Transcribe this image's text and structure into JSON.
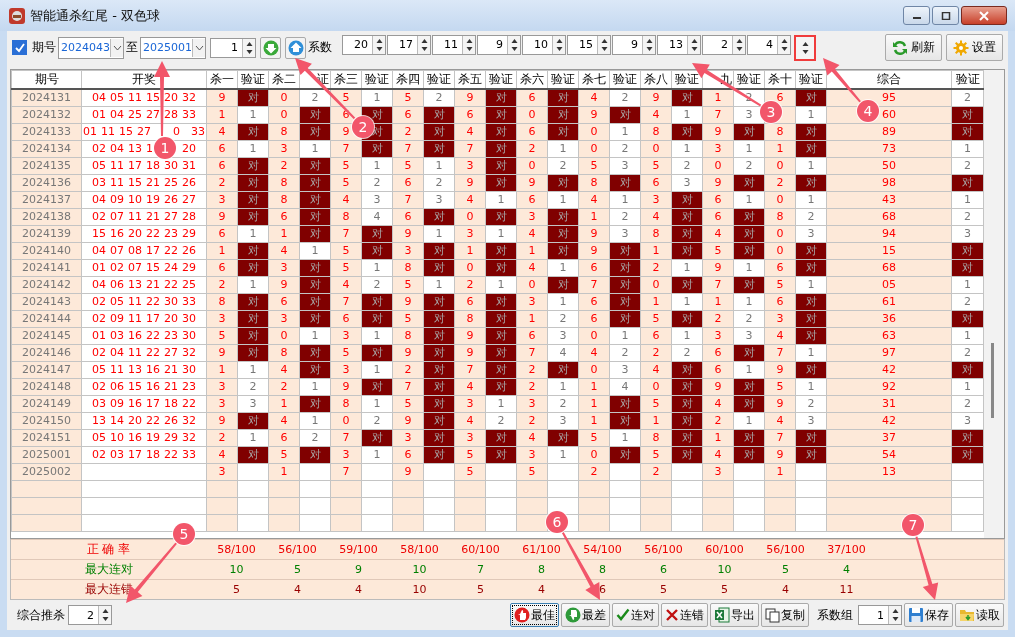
{
  "window": {
    "title": "智能通杀红尾 - 双色球"
  },
  "toolbar": {
    "period_checkbox": {
      "label": "期号",
      "checked": true
    },
    "from": "2024043",
    "to_label": "至",
    "to": "2025001",
    "step": "1",
    "coef_label": "系数",
    "coefficients": [
      "20",
      "17",
      "11",
      "9",
      "10",
      "15",
      "9",
      "13",
      "2",
      "4"
    ],
    "buttons": [
      {
        "label": "刷新"
      },
      {
        "label": "设置"
      }
    ]
  },
  "table": {
    "columns": [
      "期号",
      "开奖",
      "杀一",
      "验证",
      "杀二",
      "证",
      "杀三",
      "验证",
      "杀四",
      "验证",
      "杀五",
      "验证",
      "杀六",
      "验证",
      "杀七",
      "验证",
      "杀八",
      "验证",
      "九",
      "验证",
      "杀十",
      "验证",
      "综合",
      "验证"
    ],
    "rows": [
      {
        "period": "2024131",
        "balls": [
          "04",
          "05",
          "11",
          "15",
          "20",
          "32"
        ],
        "kills": [
          "9",
          "0",
          "5",
          "5",
          "9",
          "6",
          "4",
          "9",
          "1",
          "6"
        ],
        "total": "95",
        "checks": [
          "对",
          "2",
          "1",
          "2",
          "对",
          "对",
          "2",
          "对",
          "2",
          "对",
          "2"
        ],
        "hits": [
          true,
          false,
          false,
          false,
          true,
          true,
          false,
          true,
          false,
          true,
          false
        ]
      },
      {
        "period": "2024132",
        "balls": [
          "01",
          "04",
          "25",
          "27",
          "28",
          "33"
        ],
        "kills": [
          "1",
          "0",
          "6",
          "6",
          "6",
          "0",
          "9",
          "4",
          "7"
        ],
        "total": "60",
        "checks": [
          "1",
          "对",
          "对",
          "对",
          "对",
          "对",
          "对",
          "1",
          "3",
          "1",
          "对"
        ],
        "hits": [
          false,
          true,
          true,
          true,
          true,
          true,
          true,
          false,
          false,
          false,
          true
        ]
      },
      {
        "period": "2024133",
        "balls": [
          "01",
          "11",
          "15",
          "27"
        ],
        "balls_end": [
          "0",
          "33"
        ],
        "kills": [
          "4",
          "8",
          "9",
          "2",
          "4",
          "6",
          "0",
          "8",
          "9",
          "8"
        ],
        "total": "89",
        "checks": [
          "对",
          "对",
          "对",
          "对",
          "对",
          "对",
          "1",
          "对",
          "对",
          "对",
          "对"
        ],
        "hits": [
          true,
          true,
          true,
          true,
          true,
          true,
          false,
          true,
          true,
          true,
          true
        ]
      },
      {
        "period": "2024134",
        "balls": [
          "02",
          "04",
          "13",
          "1"
        ],
        "balls_end": [
          "20"
        ],
        "kills": [
          "6",
          "3",
          "7",
          "7",
          "7",
          "2",
          "0",
          "0",
          "3",
          "1"
        ],
        "total": "73",
        "checks": [
          "1",
          "1",
          "对",
          "对",
          "对",
          "1",
          "2",
          "1",
          "1",
          "对",
          "1"
        ],
        "hits": [
          false,
          false,
          true,
          true,
          true,
          false,
          false,
          false,
          false,
          true,
          false
        ]
      },
      {
        "period": "2024135",
        "balls": [
          "05",
          "11",
          "17",
          "18",
          "30",
          "31"
        ],
        "kills": [
          "6",
          "2",
          "5",
          "5",
          "3",
          "0",
          "5",
          "5",
          "0",
          "0"
        ],
        "total": "50",
        "checks": [
          "对",
          "对",
          "1",
          "1",
          "对",
          "2",
          "3",
          "2",
          "2",
          "1",
          "2"
        ],
        "hits": [
          true,
          true,
          false,
          false,
          true,
          false,
          false,
          false,
          false,
          false,
          false
        ]
      },
      {
        "period": "2024136",
        "balls": [
          "03",
          "11",
          "15",
          "21",
          "25",
          "26"
        ],
        "kills": [
          "2",
          "8",
          "5",
          "6",
          "9",
          "9",
          "8",
          "6",
          "9",
          "2"
        ],
        "total": "98",
        "checks": [
          "对",
          "对",
          "2",
          "2",
          "对",
          "对",
          "对",
          "3",
          "对",
          "对",
          "对"
        ],
        "hits": [
          true,
          true,
          false,
          false,
          true,
          true,
          true,
          false,
          true,
          true,
          true
        ]
      },
      {
        "period": "2024137",
        "balls": [
          "04",
          "09",
          "10",
          "19",
          "26",
          "27"
        ],
        "kills": [
          "3",
          "8",
          "4",
          "7",
          "4",
          "6",
          "4",
          "3",
          "6",
          "0"
        ],
        "total": "43",
        "checks": [
          "对",
          "对",
          "3",
          "3",
          "1",
          "1",
          "1",
          "对",
          "1",
          "1",
          "1"
        ],
        "hits": [
          true,
          true,
          false,
          false,
          false,
          false,
          false,
          true,
          false,
          false,
          false
        ]
      },
      {
        "period": "2024138",
        "balls": [
          "02",
          "07",
          "11",
          "21",
          "27",
          "28"
        ],
        "kills": [
          "9",
          "6",
          "8",
          "6",
          "0",
          "3",
          "1",
          "4",
          "6",
          "8"
        ],
        "total": "68",
        "checks": [
          "对",
          "对",
          "4",
          "对",
          "对",
          "对",
          "2",
          "对",
          "对",
          "2",
          "2"
        ],
        "hits": [
          true,
          true,
          false,
          true,
          true,
          true,
          false,
          true,
          true,
          false,
          false
        ]
      },
      {
        "period": "2024139",
        "balls": [
          "15",
          "16",
          "20",
          "22",
          "23",
          "29"
        ],
        "kills": [
          "6",
          "1",
          "7",
          "9",
          "3",
          "4",
          "9",
          "8",
          "4",
          "0"
        ],
        "total": "94",
        "checks": [
          "1",
          "对",
          "对",
          "1",
          "1",
          "对",
          "3",
          "对",
          "对",
          "3",
          "3"
        ],
        "hits": [
          false,
          true,
          true,
          false,
          false,
          true,
          false,
          true,
          true,
          false,
          false
        ]
      },
      {
        "period": "2024140",
        "balls": [
          "04",
          "07",
          "08",
          "17",
          "22",
          "26"
        ],
        "kills": [
          "1",
          "4",
          "5",
          "3",
          "1",
          "1",
          "9",
          "1",
          "5",
          "0"
        ],
        "total": "15",
        "checks": [
          "对",
          "1",
          "对",
          "对",
          "对",
          "对",
          "对",
          "对",
          "对",
          "对",
          "对"
        ],
        "hits": [
          true,
          false,
          true,
          true,
          true,
          true,
          true,
          true,
          true,
          true,
          true
        ]
      },
      {
        "period": "2024141",
        "balls": [
          "01",
          "02",
          "07",
          "15",
          "24",
          "29"
        ],
        "kills": [
          "6",
          "3",
          "5",
          "8",
          "0",
          "4",
          "6",
          "2",
          "9",
          "6"
        ],
        "total": "68",
        "checks": [
          "对",
          "对",
          "1",
          "对",
          "对",
          "1",
          "对",
          "1",
          "1",
          "对",
          "对"
        ],
        "hits": [
          true,
          true,
          false,
          true,
          true,
          false,
          true,
          false,
          false,
          true,
          true
        ]
      },
      {
        "period": "2024142",
        "balls": [
          "04",
          "06",
          "13",
          "21",
          "22",
          "25"
        ],
        "kills": [
          "2",
          "9",
          "4",
          "5",
          "2",
          "0",
          "7",
          "0",
          "7",
          "5"
        ],
        "total": "05",
        "checks": [
          "1",
          "对",
          "2",
          "1",
          "1",
          "对",
          "对",
          "对",
          "对",
          "1",
          "1"
        ],
        "hits": [
          false,
          true,
          false,
          false,
          false,
          true,
          true,
          true,
          true,
          false,
          false
        ]
      },
      {
        "period": "2024143",
        "balls": [
          "02",
          "05",
          "11",
          "22",
          "30",
          "33"
        ],
        "kills": [
          "8",
          "6",
          "7",
          "9",
          "6",
          "3",
          "6",
          "1",
          "1",
          "6"
        ],
        "total": "61",
        "checks": [
          "对",
          "对",
          "对",
          "对",
          "对",
          "1",
          "对",
          "1",
          "1",
          "对",
          "2"
        ],
        "hits": [
          true,
          true,
          true,
          true,
          true,
          false,
          true,
          false,
          false,
          true,
          false
        ]
      },
      {
        "period": "2024144",
        "balls": [
          "02",
          "09",
          "11",
          "17",
          "20",
          "30"
        ],
        "kills": [
          "3",
          "3",
          "6",
          "5",
          "8",
          "1",
          "6",
          "5",
          "2",
          "3"
        ],
        "total": "36",
        "checks": [
          "对",
          "对",
          "对",
          "对",
          "对",
          "2",
          "对",
          "对",
          "2",
          "对",
          "对"
        ],
        "hits": [
          true,
          true,
          true,
          true,
          true,
          false,
          true,
          true,
          false,
          true,
          true
        ]
      },
      {
        "period": "2024145",
        "balls": [
          "01",
          "03",
          "16",
          "22",
          "23",
          "30"
        ],
        "kills": [
          "5",
          "0",
          "3",
          "8",
          "9",
          "6",
          "0",
          "6",
          "3",
          "4"
        ],
        "total": "63",
        "checks": [
          "对",
          "1",
          "1",
          "对",
          "对",
          "3",
          "1",
          "1",
          "3",
          "对",
          "1"
        ],
        "hits": [
          true,
          false,
          false,
          true,
          true,
          false,
          false,
          false,
          false,
          true,
          false
        ]
      },
      {
        "period": "2024146",
        "balls": [
          "02",
          "04",
          "11",
          "22",
          "27",
          "32"
        ],
        "kills": [
          "9",
          "8",
          "5",
          "9",
          "9",
          "7",
          "4",
          "2",
          "6",
          "7"
        ],
        "total": "97",
        "checks": [
          "对",
          "对",
          "对",
          "对",
          "对",
          "4",
          "2",
          "2",
          "对",
          "1",
          "2"
        ],
        "hits": [
          true,
          true,
          true,
          true,
          true,
          false,
          false,
          false,
          true,
          false,
          false
        ]
      },
      {
        "period": "2024147",
        "balls": [
          "05",
          "11",
          "13",
          "16",
          "21",
          "30"
        ],
        "kills": [
          "1",
          "4",
          "3",
          "2",
          "7",
          "2",
          "0",
          "4",
          "6",
          "9"
        ],
        "total": "42",
        "checks": [
          "1",
          "对",
          "1",
          "对",
          "对",
          "对",
          "3",
          "对",
          "1",
          "对",
          "对"
        ],
        "hits": [
          false,
          true,
          false,
          true,
          true,
          true,
          false,
          true,
          false,
          true,
          true
        ]
      },
      {
        "period": "2024148",
        "balls": [
          "02",
          "06",
          "15",
          "16",
          "21",
          "23"
        ],
        "kills": [
          "3",
          "2",
          "9",
          "7",
          "4",
          "2",
          "1",
          "0",
          "9",
          "5"
        ],
        "total": "92",
        "checks": [
          "2",
          "1",
          "对",
          "对",
          "对",
          "1",
          "4",
          "对",
          "对",
          "1",
          "1"
        ],
        "hits": [
          false,
          false,
          true,
          true,
          true,
          false,
          false,
          true,
          true,
          false,
          false
        ]
      },
      {
        "period": "2024149",
        "balls": [
          "03",
          "09",
          "16",
          "17",
          "18",
          "22"
        ],
        "kills": [
          "3",
          "1",
          "8",
          "5",
          "3",
          "3",
          "1",
          "5",
          "4",
          "9"
        ],
        "total": "31",
        "checks": [
          "3",
          "对",
          "1",
          "对",
          "1",
          "2",
          "对",
          "对",
          "对",
          "2",
          "2"
        ],
        "hits": [
          false,
          true,
          false,
          true,
          false,
          false,
          true,
          true,
          true,
          false,
          false
        ]
      },
      {
        "period": "2024150",
        "balls": [
          "13",
          "14",
          "20",
          "22",
          "26",
          "32"
        ],
        "kills": [
          "9",
          "4",
          "0",
          "9",
          "4",
          "2",
          "1",
          "1",
          "2",
          "4"
        ],
        "total": "42",
        "checks": [
          "对",
          "1",
          "2",
          "对",
          "2",
          "3",
          "对",
          "对",
          "1",
          "3",
          "3"
        ],
        "hits": [
          true,
          false,
          false,
          true,
          false,
          false,
          true,
          true,
          false,
          false,
          false
        ]
      },
      {
        "period": "2024151",
        "balls": [
          "05",
          "10",
          "16",
          "19",
          "29",
          "32"
        ],
        "kills": [
          "2",
          "6",
          "7",
          "3",
          "3",
          "4",
          "5",
          "8",
          "1",
          "7"
        ],
        "total": "37",
        "checks": [
          "1",
          "2",
          "对",
          "对",
          "对",
          "对",
          "1",
          "对",
          "对",
          "对",
          "对"
        ],
        "hits": [
          false,
          false,
          true,
          true,
          true,
          true,
          false,
          true,
          true,
          true,
          true
        ]
      },
      {
        "period": "2025001",
        "balls": [
          "02",
          "03",
          "17",
          "18",
          "22",
          "33"
        ],
        "kills": [
          "4",
          "5",
          "3",
          "6",
          "5",
          "3",
          "0",
          "5",
          "4",
          "9"
        ],
        "total": "54",
        "checks": [
          "对",
          "对",
          "1",
          "对",
          "对",
          "1",
          "对",
          "对",
          "对",
          "对",
          "对"
        ],
        "hits": [
          true,
          true,
          false,
          true,
          true,
          false,
          true,
          true,
          true,
          true,
          true
        ]
      },
      {
        "period": "2025002",
        "kills": [
          "3",
          "1",
          "7",
          "9",
          "5",
          "5",
          "2",
          "2",
          "3",
          "1"
        ],
        "total": "13"
      }
    ]
  },
  "stats": [
    {
      "kind": "rate",
      "label": "正 确 率",
      "values": [
        "58/100",
        "56/100",
        "59/100",
        "58/100",
        "60/100",
        "61/100",
        "54/100",
        "56/100",
        "60/100",
        "56/100",
        "37/100"
      ]
    },
    {
      "kind": "max_hit",
      "label": "最大连对",
      "values": [
        "10",
        "5",
        "9",
        "10",
        "7",
        "8",
        "8",
        "6",
        "10",
        "5",
        "4"
      ]
    },
    {
      "kind": "max_miss",
      "label": "最大连错",
      "values": [
        "5",
        "4",
        "4",
        "10",
        "5",
        "4",
        "6",
        "5",
        "5",
        "4",
        "11"
      ]
    }
  ],
  "bottom": {
    "combo_label": "综合推杀",
    "combo_value": "2",
    "buttons": [
      {
        "label": "最佳",
        "focused": true
      },
      {
        "label": "最差",
        "focused": false
      },
      {
        "label": "连对",
        "focused": false
      },
      {
        "label": "连错",
        "focused": false
      },
      {
        "label": "导出",
        "focused": false
      },
      {
        "label": "复制",
        "focused": false
      }
    ],
    "group_label": "系数组",
    "group_value": "1",
    "file_buttons": [
      {
        "label": "保存"
      },
      {
        "label": "读取"
      }
    ]
  },
  "callouts": [
    {
      "number": "1"
    },
    {
      "number": "2"
    },
    {
      "number": "3"
    },
    {
      "number": "4"
    },
    {
      "number": "5"
    },
    {
      "number": "6"
    },
    {
      "number": "7"
    }
  ]
}
